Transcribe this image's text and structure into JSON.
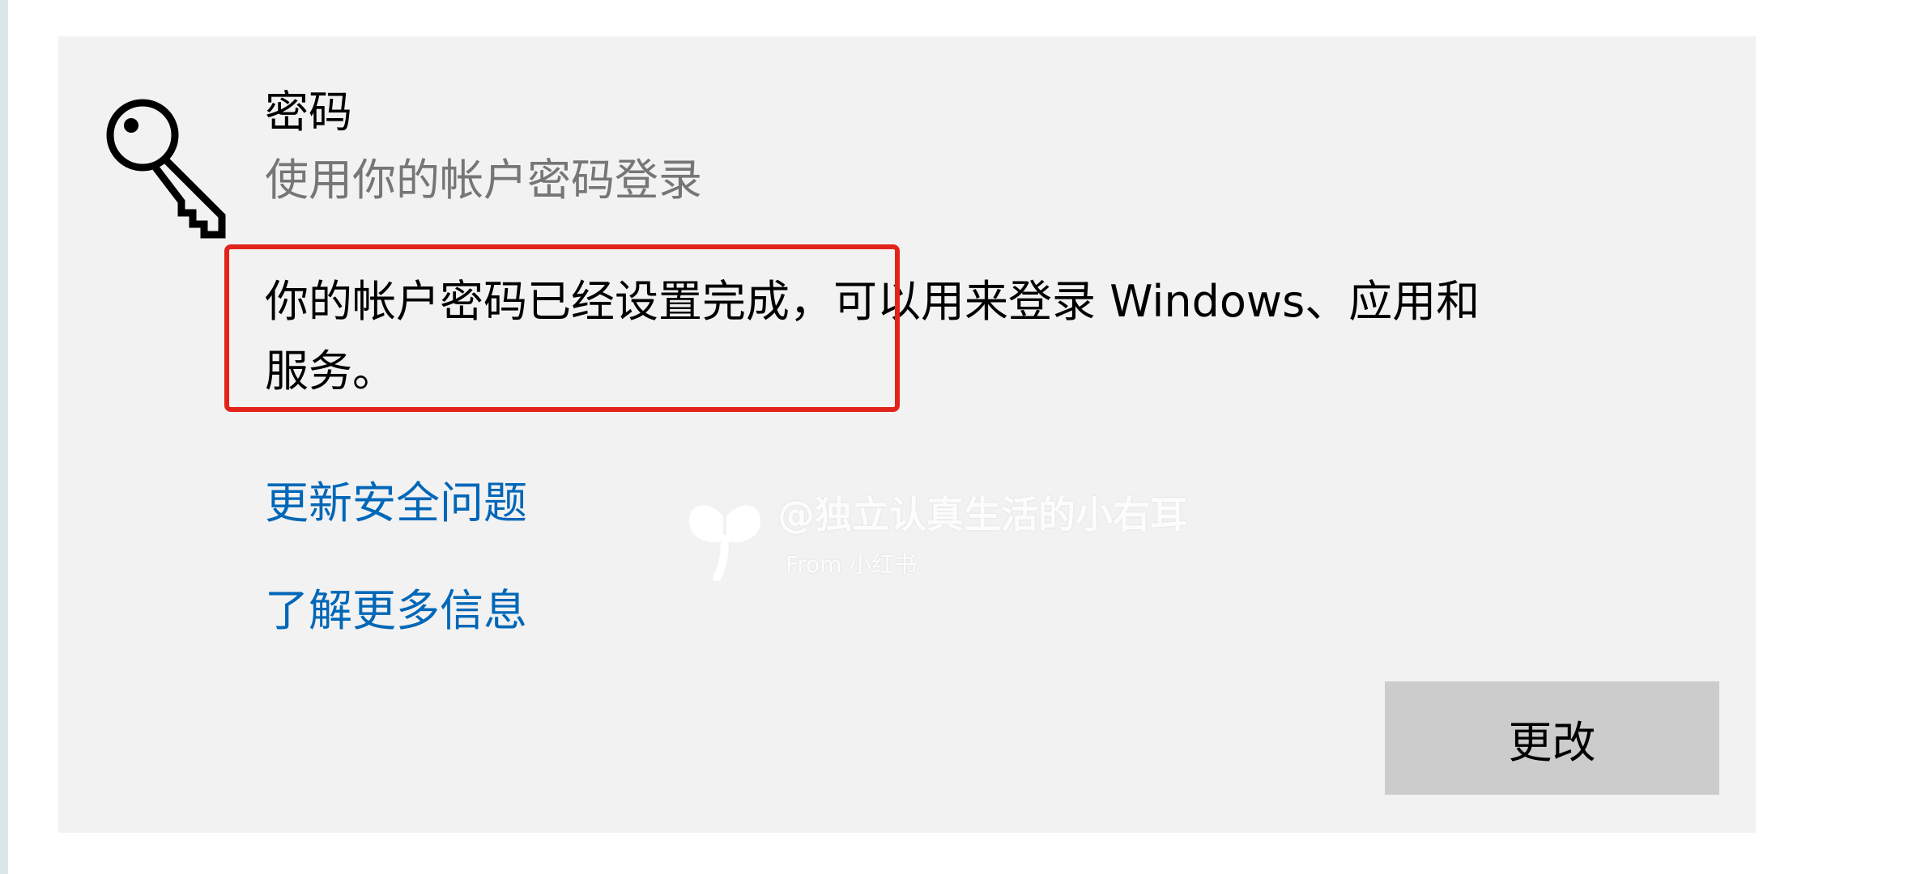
{
  "password_section": {
    "title": "密码",
    "subtitle": "使用你的帐户密码登录",
    "status_line1": "你的帐户密码已经设置完成，可以用来登录 Windows、应用和",
    "status_line2": "服务。",
    "icon": "key-icon"
  },
  "links": {
    "update_security_questions": "更新安全问题",
    "learn_more": "了解更多信息"
  },
  "buttons": {
    "change": "更改"
  },
  "annotation": {
    "highlight_color": "#e2231a"
  },
  "watermark": {
    "handle": "@独立认真生活的小右耳",
    "from": "From 小红书"
  },
  "colors": {
    "panel_bg": "#f2f2f2",
    "link": "#0067b8",
    "subtitle": "#767676",
    "button_bg": "#cccccc"
  }
}
